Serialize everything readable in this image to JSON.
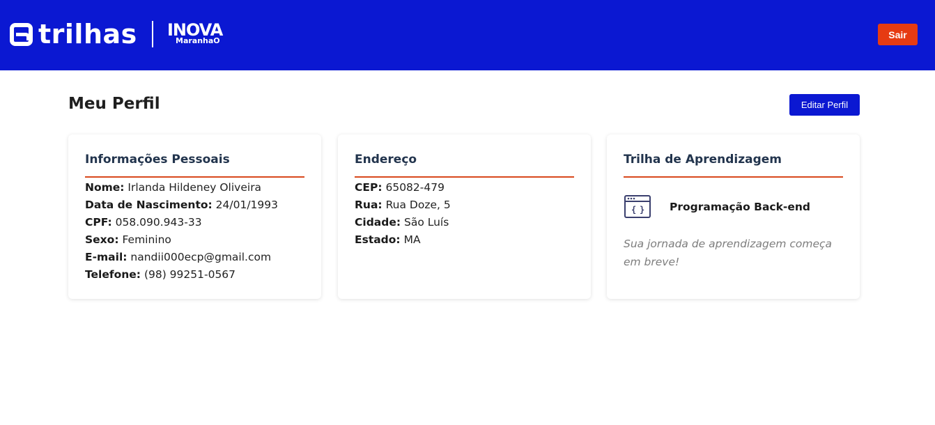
{
  "header": {
    "brand_name": "trilhas",
    "partner_name": "INOVA",
    "partner_sub": "MaranhaO",
    "logout_label": "Sair",
    "colors": {
      "header_bg": "#0b18d2",
      "logout_bg": "#e63b12",
      "accent_line": "#d9481c"
    }
  },
  "page": {
    "title": "Meu Perfil",
    "edit_label": "Editar Perfil"
  },
  "personal": {
    "title": "Informações Pessoais",
    "fields": [
      {
        "label": "Nome:",
        "value": "Irlanda Hildeney Oliveira"
      },
      {
        "label": "Data de Nascimento:",
        "value": "24/01/1993"
      },
      {
        "label": "CPF:",
        "value": "058.090.943-33"
      },
      {
        "label": "Sexo:",
        "value": "Feminino"
      },
      {
        "label": "E-mail:",
        "value": "nandii000ecp@gmail.com"
      },
      {
        "label": "Telefone:",
        "value": "(98) 99251-0567"
      }
    ]
  },
  "address": {
    "title": "Endereço",
    "fields": [
      {
        "label": "CEP:",
        "value": "65082-479"
      },
      {
        "label": "Rua:",
        "value": "Rua Doze, 5"
      },
      {
        "label": "Cidade:",
        "value": "São Luís"
      },
      {
        "label": "Estado:",
        "value": "MA"
      }
    ]
  },
  "learning": {
    "title": "Trilha de Aprendizagem",
    "track_icon": "code-window-icon",
    "track_name": "Programação Back-end",
    "note": "Sua jornada de aprendizagem começa em breve!"
  }
}
